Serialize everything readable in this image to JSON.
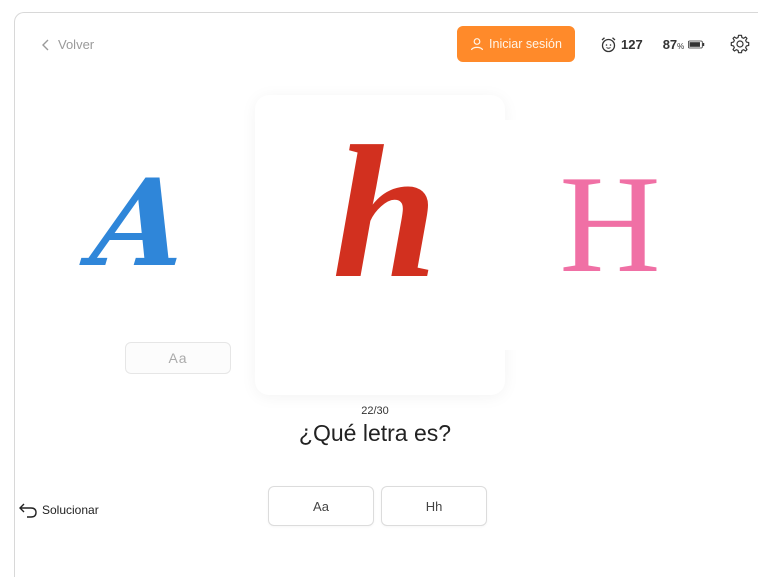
{
  "header": {
    "back_label": "Volver",
    "login_label": "Iniciar sesión",
    "score": "127",
    "battery_percent": "87",
    "percent_sign": "%"
  },
  "cards": {
    "left_letter": "A",
    "center_letter": "h",
    "right_letter": "H",
    "left_pill": "Aa"
  },
  "quiz": {
    "progress": "22/30",
    "question": "¿Qué letra es?",
    "solve_label": "Solucionar",
    "answers": [
      "Aa",
      "Hh"
    ]
  },
  "colors": {
    "login_bg": "#ff8a2a",
    "letter_a": "#2f86d9",
    "letter_h": "#d2301f",
    "letter_H": "#f070a5"
  },
  "icons": {
    "back": "chevron-left-icon",
    "login": "user-icon",
    "score": "alarm-clock-icon",
    "battery": "battery-icon",
    "settings": "gear-icon",
    "solve": "undo-arrow-icon"
  }
}
